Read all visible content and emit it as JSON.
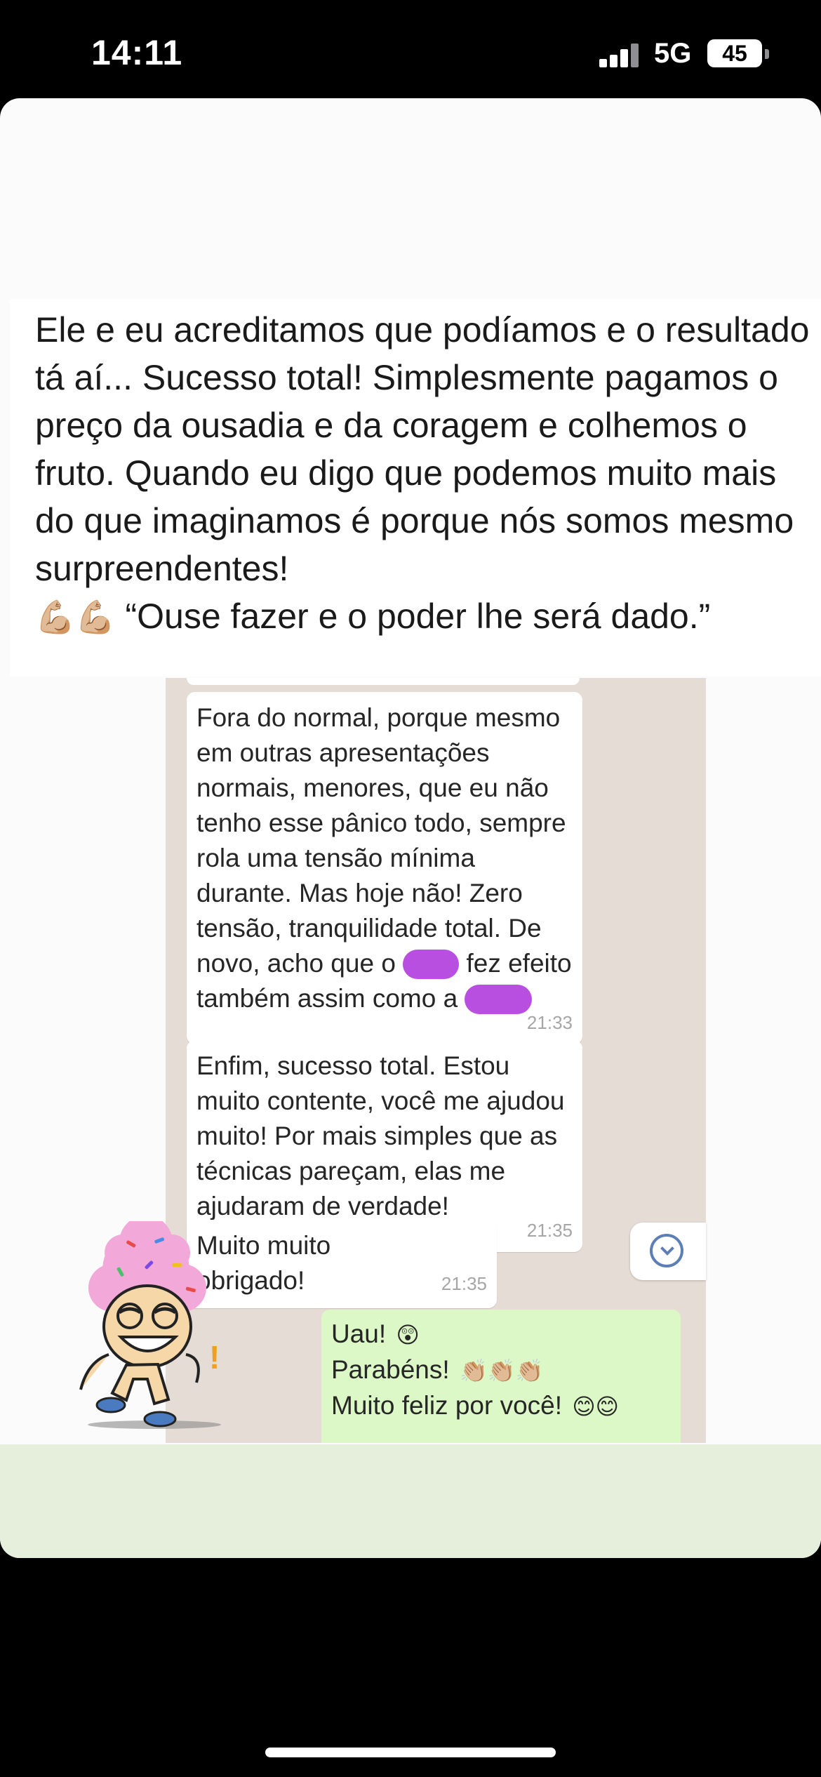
{
  "status_bar": {
    "time": "14:11",
    "network": "5G",
    "battery": "45"
  },
  "caption": {
    "text": "Ele e eu acreditamos que podíamos e o resultado tá aí... Sucesso total! Simplesmente pagamos o preço da ousadia e da coragem e colhemos o fruto. Quando eu digo que podemos muito mais do que imaginamos é porque nós somos mesmo surpreendentes!",
    "icons": "💪🏼💪🏼",
    "quote": "“Ouse fazer e o poder lhe será dado.”"
  },
  "chat": {
    "messages": [
      {
        "part1": "Fora do normal, porque mesmo em outras apresentações normais, menores, que eu não tenho esse pânico todo, sempre rola uma tensão mínima durante. Mas hoje não! Zero tensão, tranquilidade total. De novo, acho que o",
        "part2": "fez efeito também assim como a",
        "time": "21:33"
      },
      {
        "text": "Enfim, sucesso total. Estou muito contente, você me ajudou muito! Por mais simples que as técnicas pareçam, elas me ajudaram de verdade!",
        "time": "21:35"
      },
      {
        "text": "Muito muito obrigado!",
        "time": "21:35"
      }
    ],
    "outgoing": {
      "line1": "Uau!",
      "line1_emoji": "😲",
      "line2": "Parabéns!",
      "line2_emoji": "👏🏼👏🏼👏🏼",
      "line3": "Muito feliz por você!",
      "line3_emoji": "😊😊"
    }
  },
  "colors": {
    "redaction": "#b94fe0",
    "chat_background": "#e5ddd5",
    "outgoing_bubble": "#dcf8c6",
    "bottom_strip": "#e6eedc"
  }
}
